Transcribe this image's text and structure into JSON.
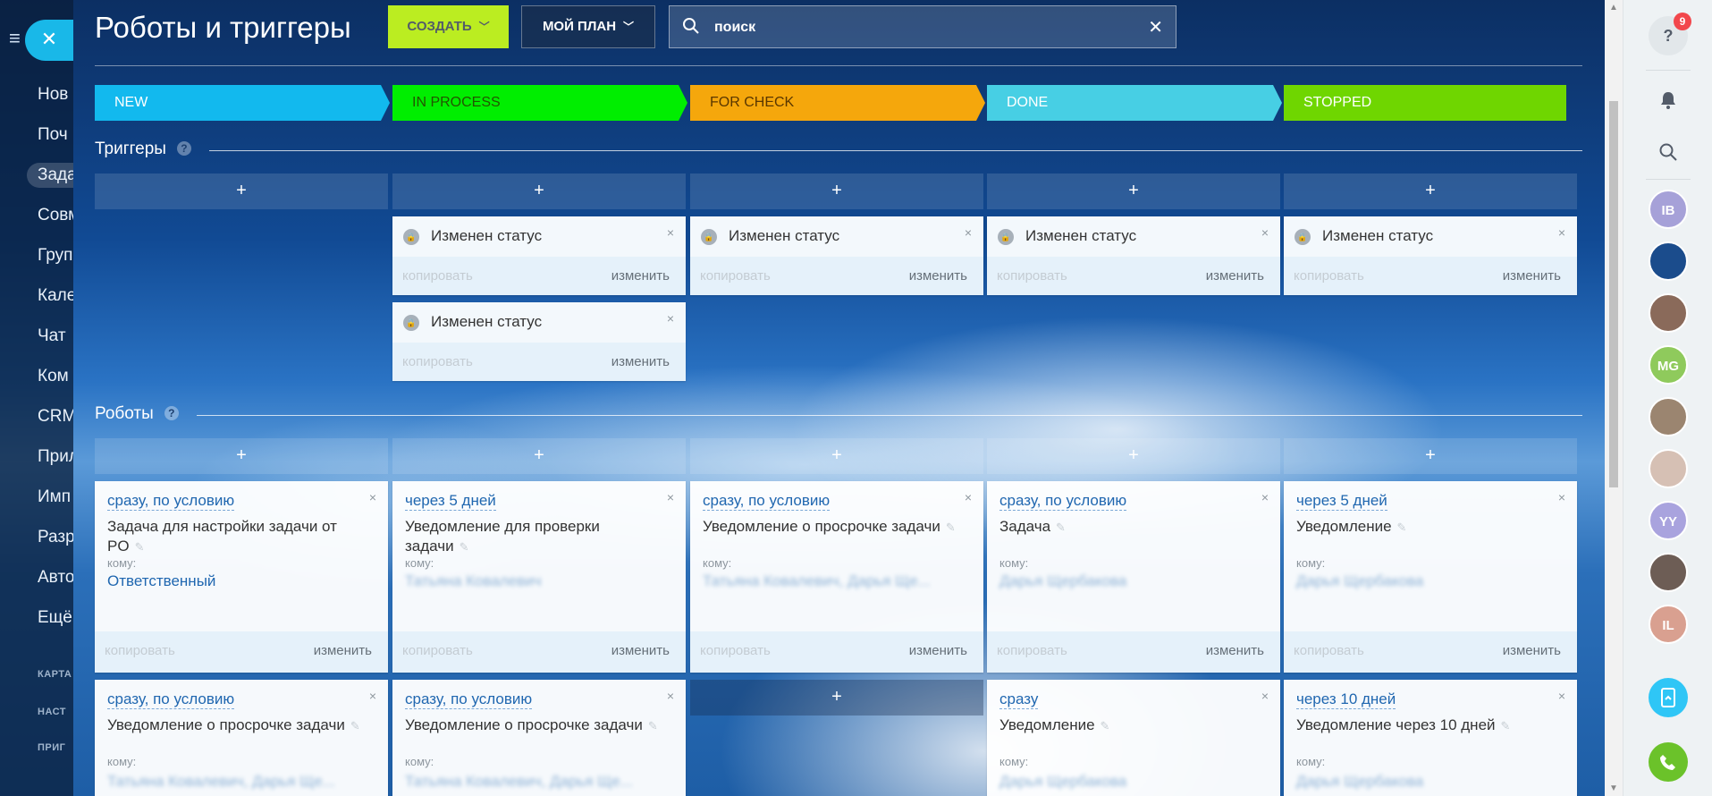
{
  "page": {
    "title": "Роботы и триггеры",
    "create_label": "СОЗДАТЬ",
    "plan_label": "МОЙ ПЛАН",
    "search_placeholder": "поиск"
  },
  "left_menu": {
    "items": [
      "Нов",
      "Поч",
      "Зада",
      "Совм",
      "Груп",
      "Кале",
      "Чат",
      "Ком",
      "CRM",
      "Прил",
      "Имп",
      "Разр",
      "Авто",
      "Ещё"
    ],
    "small_items": [
      "КАРТА",
      "НАСТ",
      "ПРИГ"
    ]
  },
  "stages": [
    {
      "label": "NEW",
      "color": "#12b9ee",
      "text_color": "#ffffff"
    },
    {
      "label": "IN PROCESS",
      "color": "#00ee00",
      "text_color": "#225500"
    },
    {
      "label": "FOR CHECK",
      "color": "#f5a70c",
      "text_color": "#5a3700"
    },
    {
      "label": "DONE",
      "color": "#47cfe4",
      "text_color": "#ffffff"
    },
    {
      "label": "STOPPED",
      "color": "#6fd600",
      "text_color": "#ffffff"
    }
  ],
  "triggers_section": {
    "label": "Триггеры",
    "help": "?"
  },
  "robots_section": {
    "label": "Роботы",
    "help": "?"
  },
  "add_label": "+",
  "copy_label": "копировать",
  "edit_label": "изменить",
  "close_glyph": "×",
  "to_label": "кому:",
  "triggers": [
    [],
    [
      "Изменен статус",
      "Изменен статус"
    ],
    [
      "Изменен статус"
    ],
    [
      "Изменен статус"
    ],
    [
      "Изменен статус"
    ]
  ],
  "robots": [
    [
      {
        "when": "сразу, по условию",
        "name": "Задача для настройки задачи от PO",
        "to": "Ответственный",
        "blurred": false
      },
      {
        "when": "сразу, по условию",
        "name": "Уведомление о просрочке задачи",
        "to": "Татьяна Ковалевич, Дарья Ще...",
        "blurred": true
      }
    ],
    [
      {
        "when": "через 5 дней",
        "name": "Уведомление для проверки задачи",
        "to": "Татьяна Ковалевич",
        "blurred": true
      },
      {
        "when": "сразу, по условию",
        "name": "Уведомление о просрочке задачи",
        "to": "Татьяна Ковалевич, Дарья Ще...",
        "blurred": true
      }
    ],
    [
      {
        "when": "сразу, по условию",
        "name": "Уведомление о просрочке задачи",
        "to": "Татьяна Ковалевич, Дарья Ще...",
        "blurred": true
      }
    ],
    [
      {
        "when": "сразу, по условию",
        "name": "Задача",
        "to": "Дарья Щербакова",
        "blurred": true
      },
      {
        "when": "сразу",
        "name": "Уведомление",
        "to": "Дарья Щербакова",
        "blurred": true
      }
    ],
    [
      {
        "when": "через 5 дней",
        "name": "Уведомление",
        "to": "Дарья Щербакова",
        "blurred": true
      },
      {
        "when": "через 10 дней",
        "name": "Уведомление через 10 дней",
        "to": "Дарья Щербакова",
        "blurred": true
      }
    ]
  ],
  "right_bar": {
    "help_badge": "9",
    "avatars": [
      {
        "initials": "IB",
        "color": "#a6a1d8"
      },
      {
        "initials": "",
        "color": "#1b4c8c"
      },
      {
        "initials": "",
        "color": "#8a6a5a"
      },
      {
        "initials": "MG",
        "color": "#8fca5c"
      },
      {
        "initials": "",
        "color": "#9b8570"
      },
      {
        "initials": "",
        "color": "#d6c0b4"
      },
      {
        "initials": "YY",
        "color": "#a9a3de"
      },
      {
        "initials": "",
        "color": "#6d5d55"
      },
      {
        "initials": "IL",
        "color": "#d9a090"
      }
    ]
  }
}
